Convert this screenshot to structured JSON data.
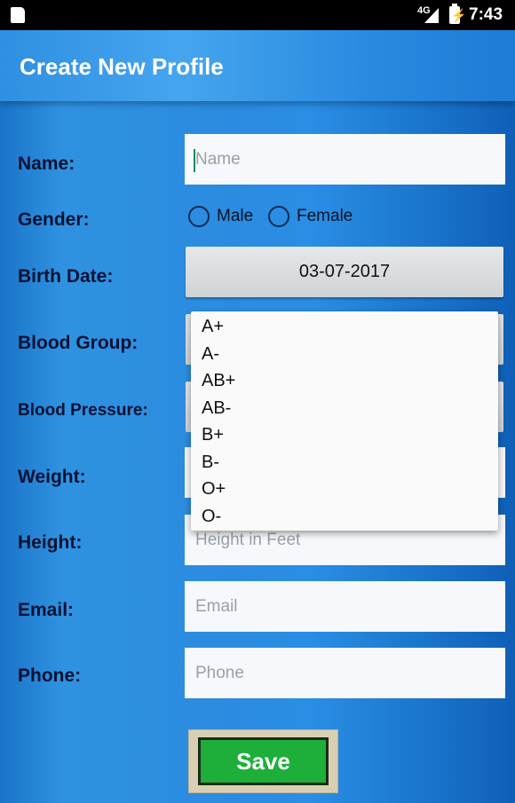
{
  "status_bar": {
    "network": "4G",
    "time": "7:43"
  },
  "app_bar": {
    "title": "Create New Profile"
  },
  "form": {
    "name_label": "Name:",
    "name_placeholder": "Name",
    "gender_label": "Gender:",
    "gender_options": [
      "Male",
      "Female"
    ],
    "birth_label": "Birth Date:",
    "birth_value": "03-07-2017",
    "blood_group_label": "Blood Group:",
    "blood_pressure_label": "Blood Pressure:",
    "weight_label": "Weight:",
    "height_label": "Height:",
    "height_placeholder": "Height in Feet",
    "email_label": "Email:",
    "email_placeholder": "Email",
    "phone_label": "Phone:",
    "phone_placeholder": "Phone",
    "save_label": "Save"
  },
  "blood_group_dropdown": {
    "options": [
      "A+",
      "A-",
      "AB+",
      "AB-",
      "B+",
      "B-",
      "O+",
      "O-"
    ]
  }
}
